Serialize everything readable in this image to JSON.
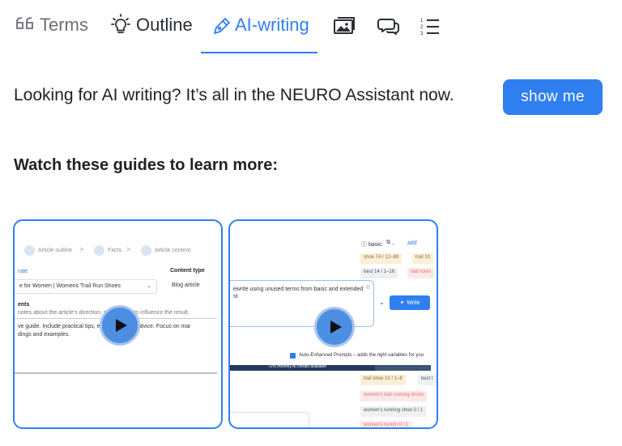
{
  "tabs": [
    {
      "label": "Terms",
      "icon": "quote-icon"
    },
    {
      "label": "Outline",
      "icon": "lightbulb-icon"
    },
    {
      "label": "AI-writing",
      "icon": "pen-icon",
      "active": true
    },
    {
      "label": "",
      "icon": "images-icon"
    },
    {
      "label": "",
      "icon": "chat-bubbles-icon"
    },
    {
      "label": "",
      "icon": "numbered-list-icon"
    }
  ],
  "promo": {
    "text": "Looking for AI writing? It’s all in the NEURO Assistant now.",
    "button_label": "show me"
  },
  "guides": {
    "heading": "Watch these guides to learn more:",
    "videos": [
      {
        "steps": [
          "Article outline",
          "Facts",
          "Article content"
        ],
        "left_label": "rate",
        "content_type_label": "Content type",
        "title_value": "e for Women | Womens Trail Run Shoes",
        "content_type_value": "Blog article",
        "notes_label": "ents",
        "notes_hint": "notes about the article's direction, pur        eel free to influence the result.",
        "body_line1": "ve guide. Include practical tips, ex         d actionable advice. Focus on mai",
        "body_line2": "dings and examples."
      },
      {
        "basic_label": "basic:",
        "add_label": "add",
        "tags": [
          {
            "text": "shoe  74 / 12–88",
            "tone": "y"
          },
          {
            "text": "trail  10",
            "tone": "y"
          },
          {
            "text": "best  14 / 1–16",
            "tone": "g"
          },
          {
            "text": "trail runni",
            "tone": "r"
          },
          {
            "text": "trail shoe  10 / 1–8",
            "tone": "y"
          },
          {
            "text": "best t",
            "tone": "g"
          },
          {
            "text": "women's trail running shoes",
            "tone": "r"
          },
          {
            "text": "women's running shoe  0 / 1",
            "tone": "g"
          },
          {
            "text": "women's runnin  0 / 1",
            "tone": "r"
          }
        ],
        "prompt_text": "ewrite using unused terms from basic and extended",
        "prompt_text2": "st",
        "write_label": "Write",
        "auto_label": "Auto-Enhanced Prompts – adds the right variables for you",
        "credits_label": "72% monthly AI credits available",
        "credits_percent": 72
      }
    ]
  }
}
